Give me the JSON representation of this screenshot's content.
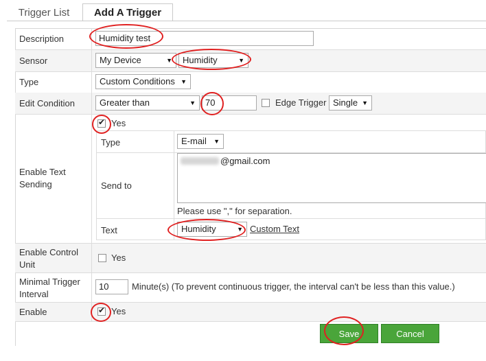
{
  "tabs": [
    {
      "label": "Trigger List"
    },
    {
      "label": "Add A Trigger"
    }
  ],
  "form": {
    "description": {
      "label": "Description",
      "value": "Humidity test"
    },
    "sensor": {
      "label": "Sensor",
      "device": "My Device",
      "sensor": "Humidity"
    },
    "type": {
      "label": "Type",
      "value": "Custom Conditions"
    },
    "edit_condition": {
      "label": "Edit Condition",
      "operator": "Greater than",
      "value": "70",
      "edge_trigger_label": "Edge Trigger",
      "mode": "Single"
    },
    "text_sending": {
      "label": "Enable Text Sending",
      "yes_label": "Yes",
      "type_label": "Type",
      "type_value": "E-mail",
      "send_to_label": "Send to",
      "email_suffix": "@gmail.com",
      "hint": "Please use \",\" for separation.",
      "text_label": "Text",
      "text_value": "Humidity",
      "custom_text_link": "Custom Text"
    },
    "control_unit": {
      "label": "Enable Control Unit",
      "yes_label": "Yes"
    },
    "min_interval": {
      "label": "Minimal Trigger Interval",
      "value": "10",
      "note": "Minute(s) (To prevent continuous trigger, the interval can't be less than this value.)"
    },
    "enable": {
      "label": "Enable",
      "yes_label": "Yes"
    }
  },
  "buttons": {
    "save": "Save",
    "cancel": "Cancel"
  },
  "colors": {
    "button_green": "#4aa53a",
    "annotation_red": "#e02020"
  }
}
